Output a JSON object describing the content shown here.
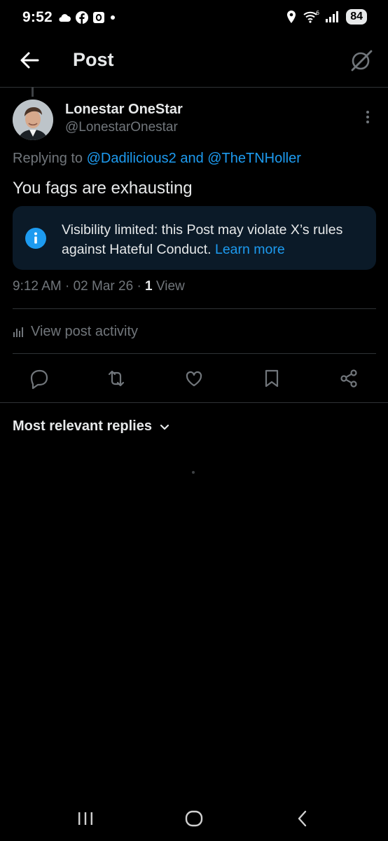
{
  "status_bar": {
    "time": "9:52",
    "battery": "84"
  },
  "header": {
    "title": "Post"
  },
  "post": {
    "display_name": "Lonestar OneStar",
    "handle": "@LonestarOnestar",
    "replying_prefix": "Replying to",
    "replying_to": "@Dadilicious2 and @TheTNHoller",
    "text": "You fags are exhausting",
    "notice": {
      "text": "Visibility limited: this Post may violate X’s rules against Hateful Conduct.",
      "link": "Learn more"
    },
    "time": "9:12 AM",
    "date": "02 Mar 26",
    "views_count": "1",
    "views_label": "View"
  },
  "activity_label": "View post activity",
  "replies_sort_label": "Most relevant replies",
  "colors": {
    "background": "#000000",
    "link": "#1d9bf0",
    "muted": "#71767b",
    "notice_bg": "#0b1a28"
  }
}
